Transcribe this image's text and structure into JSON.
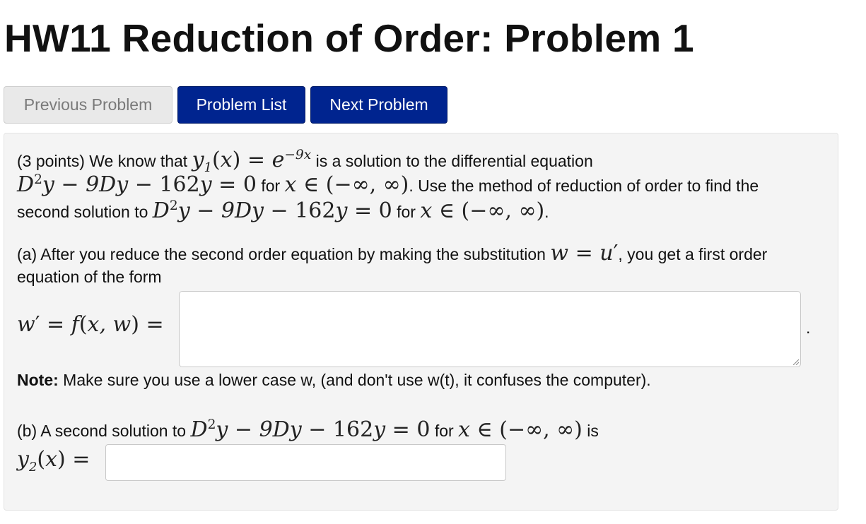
{
  "page": {
    "title": "HW11 Reduction of Order: Problem 1"
  },
  "nav": {
    "previous": "Previous Problem",
    "list": "Problem List",
    "next": "Next Problem"
  },
  "problem": {
    "points": "(3 points) We know that",
    "is_solution": "is a solution to the differential equation",
    "use_method": ". Use the method of reduction of order to find the",
    "second_solution_to": "second solution to",
    "for": "for",
    "period": ".",
    "part_a_1": "(a) After you reduce the second order equation by making the substitution",
    "part_a_2": ", you get a first order",
    "part_a_3": "equation of the form",
    "answer_a_value": "",
    "trailing_period": ".",
    "note_label": "Note:",
    "note_text": " Make sure you use a lower case w, (and don't use w(t), it confuses the computer).",
    "part_b_1": "(b) A second solution to",
    "is": "is",
    "answer_b_value": ""
  },
  "icons": {
    "resize": "resize-grip-icon"
  }
}
